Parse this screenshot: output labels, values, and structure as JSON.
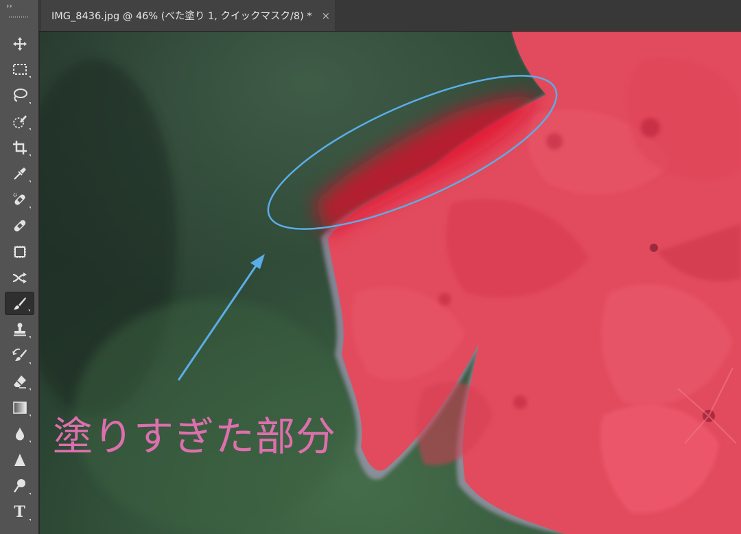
{
  "toolbar": {
    "collapse_label": "››",
    "tools": [
      {
        "name": "move-tool",
        "icon": "move-icon"
      },
      {
        "name": "marquee-tool",
        "icon": "marquee-icon"
      },
      {
        "name": "lasso-tool",
        "icon": "lasso-icon"
      },
      {
        "name": "quick-selection-tool",
        "icon": "quick-selection-icon"
      },
      {
        "name": "crop-tool",
        "icon": "crop-icon"
      },
      {
        "name": "eyedropper-tool",
        "icon": "eyedropper-icon"
      },
      {
        "name": "spot-healing-tool",
        "icon": "spot-healing-icon"
      },
      {
        "name": "healing-brush-tool",
        "icon": "bandage-icon"
      },
      {
        "name": "patch-tool",
        "icon": "patch-icon"
      },
      {
        "name": "content-aware-move-tool",
        "icon": "content-aware-move-icon"
      },
      {
        "name": "brush-tool",
        "icon": "brush-icon",
        "active": true
      },
      {
        "name": "clone-stamp-tool",
        "icon": "stamp-icon"
      },
      {
        "name": "history-brush-tool",
        "icon": "history-brush-icon"
      },
      {
        "name": "eraser-tool",
        "icon": "eraser-icon"
      },
      {
        "name": "gradient-tool",
        "icon": "gradient-icon"
      },
      {
        "name": "blur-tool",
        "icon": "drop-icon"
      },
      {
        "name": "sharpen-tool",
        "icon": "triangle-icon"
      },
      {
        "name": "dodge-tool",
        "icon": "dodge-icon"
      },
      {
        "name": "type-tool",
        "icon": "type-icon"
      }
    ],
    "type_glyph": "T"
  },
  "document_tab": {
    "title": "IMG_8436.jpg @ 46% (べた塗り 1, クイックマスク/8) *",
    "close_label": "×"
  },
  "canvas": {
    "annotation_text": "塗りすぎた部分",
    "annotation_color": "#de6fae",
    "highlight_color": "#5aaee8"
  }
}
